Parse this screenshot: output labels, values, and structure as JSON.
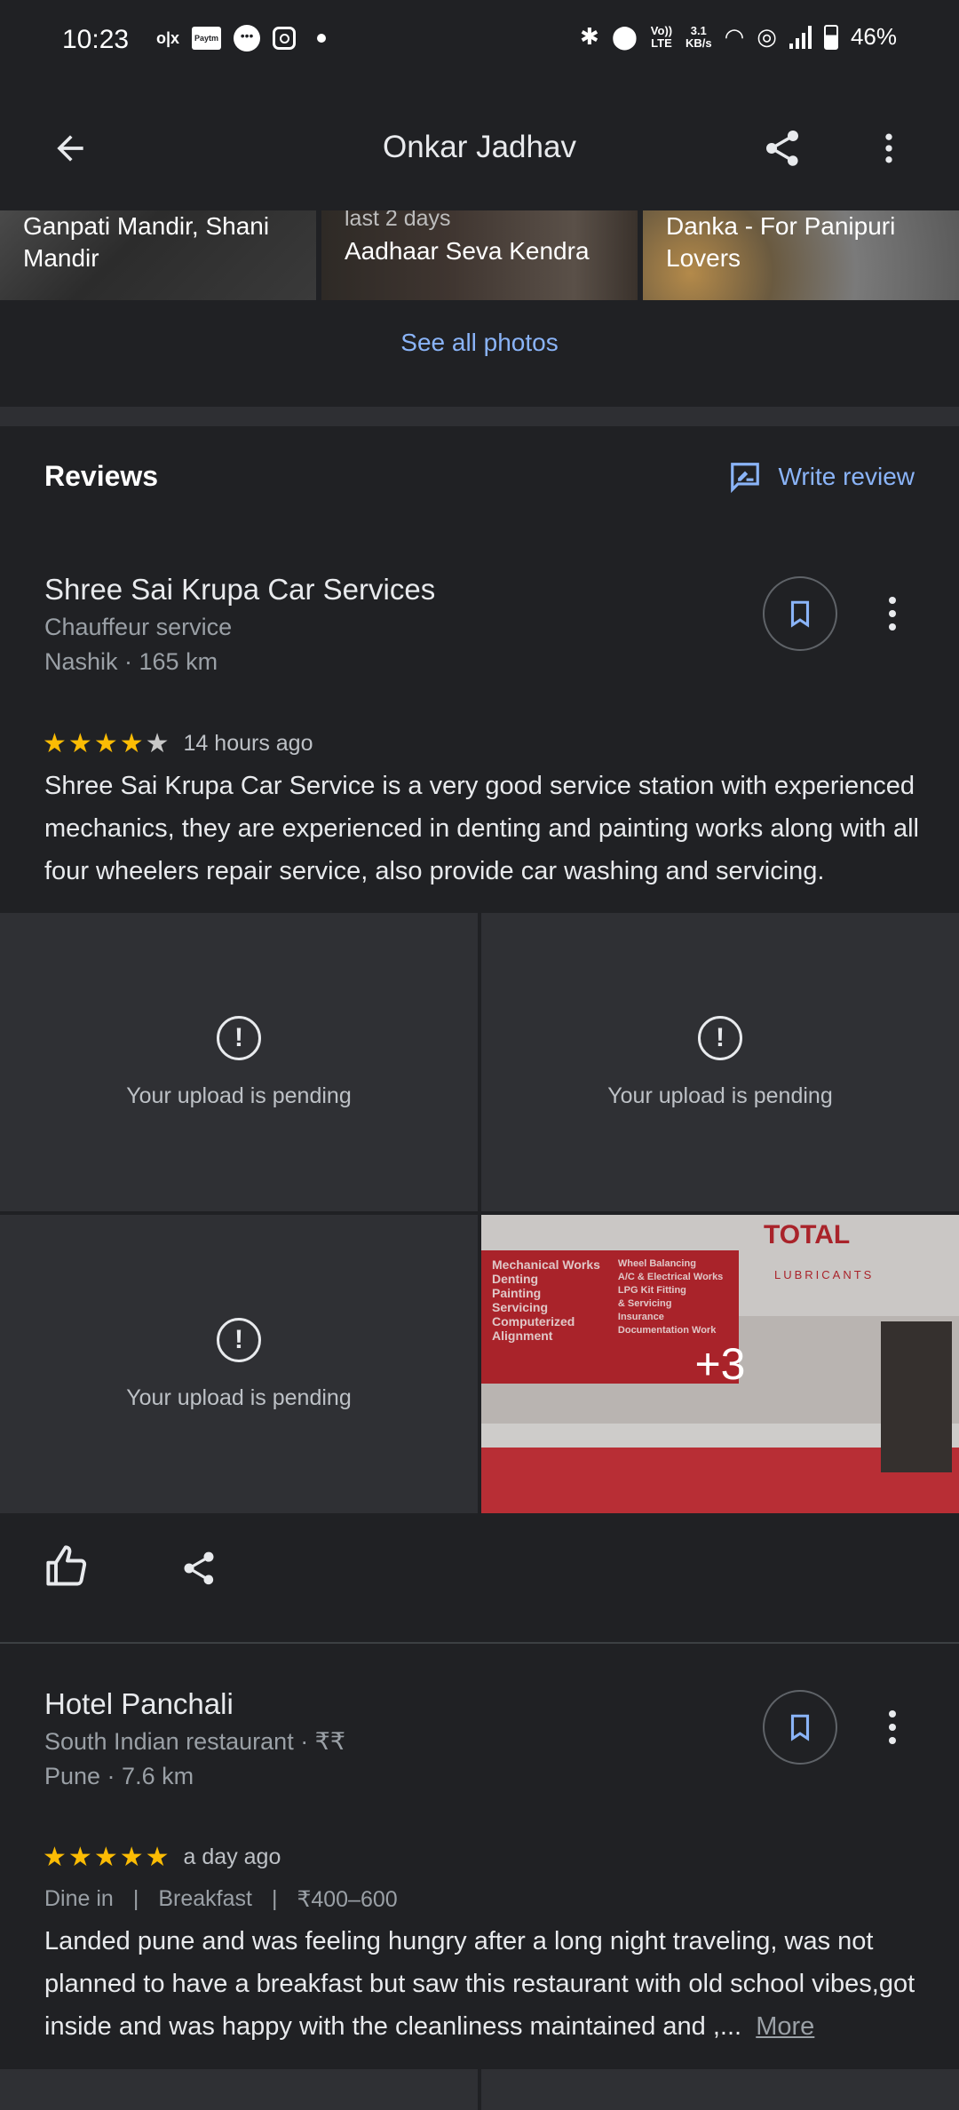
{
  "status_bar": {
    "time": "10:23",
    "olx": "o|x",
    "paytm": "Paytm",
    "volte": "Vo)) LTE",
    "speed_value": "3.1",
    "speed_unit": "KB/s",
    "battery": "46%"
  },
  "header": {
    "title": "Onkar Jadhav"
  },
  "photos": [
    {
      "title": "Ganpati Mandir, Shani Mandir"
    },
    {
      "subtitle": "last 2 days",
      "title": "Aadhaar Seva Kendra"
    },
    {
      "title": "Danka - For Panipuri Lovers"
    }
  ],
  "see_all_photos": "See all photos",
  "reviews": {
    "heading": "Reviews",
    "write_review": "Write review",
    "items": [
      {
        "place": "Shree Sai Krupa Car Services",
        "category": "Chauffeur service",
        "location": "Nashik · 165 km",
        "rating": 4,
        "time": "14 hours ago",
        "text": "Shree Sai Krupa Car Service is a very good service station with experienced mechanics, they are experienced in denting and painting works along with all four wheelers repair service, also provide car washing and servicing.",
        "pending_label": "Your upload is pending",
        "more_photos": "+3",
        "photo_sign": {
          "brand": "TOTAL",
          "sub": "LUBRICANTS",
          "left_list": [
            "Mechanical Works",
            "Denting",
            "Painting",
            "Servicing",
            "Computerized",
            "Alignment"
          ],
          "right_list": [
            "Wheel Balancing",
            "A/C & Electrical Works",
            "LPG Kit Fitting",
            "& Servicing",
            "Insurance",
            "Documentation Work"
          ]
        }
      },
      {
        "place": "Hotel Panchali",
        "category": "South Indian restaurant · ₹₹",
        "location": "Pune · 7.6 km",
        "rating": 5,
        "time": "a day ago",
        "meta": [
          "Dine in",
          "Breakfast",
          "₹400–600"
        ],
        "text": "Landed pune and was feeling hungry after a long night traveling, was not planned to have a breakfast but saw this restaurant with old school vibes,got inside and was happy with the cleanliness maintained and ,...",
        "more": "More"
      }
    ]
  },
  "colors": {
    "background": "#202124",
    "accent": "#8ab4f8",
    "star": "#fbbc04",
    "tile": "#2f3034"
  }
}
